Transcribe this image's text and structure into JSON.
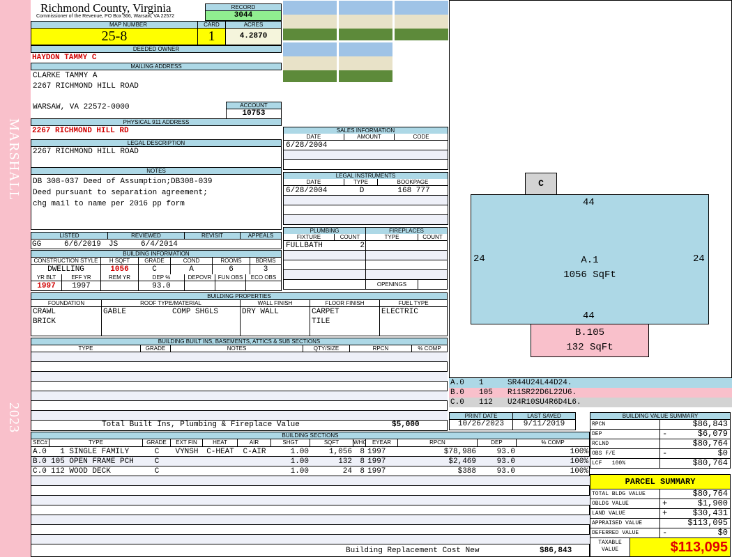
{
  "sidebar": {
    "name": "MARSHALL",
    "year": "2023"
  },
  "header": {
    "county": "Richmond County, Virginia",
    "subtitle": "Commissioner of the Revenue, PO Box 366, Warsaw, VA 22572",
    "record_label": "RECORD",
    "record": "3044"
  },
  "map": {
    "map_label": "MAP NUMBER",
    "map_number": "25-8",
    "card_label": "CARD",
    "card": "1",
    "acres_label": "ACRES",
    "acres": "4.2870"
  },
  "owner": {
    "label": "DEEDED OWNER",
    "value": "HAYDON TAMMY C"
  },
  "mailing": {
    "label": "MAILING ADDRESS",
    "line1": "CLARKE TAMMY A",
    "line2": "2267 RICHMOND HILL ROAD",
    "line3": "WARSAW, VA 22572-0000",
    "account_label": "ACCOUNT",
    "account": "10753"
  },
  "physical": {
    "label": "PHYSICAL 911 ADDRESS",
    "value": "2267 RICHMOND HILL RD"
  },
  "legal": {
    "label": "LEGAL DESCRIPTION",
    "value": "2267 RICHMOND HILL ROAD"
  },
  "notes": {
    "label": "NOTES",
    "lines": [
      "DB 308-037 Deed of Assumption;DB308-039",
      "Deed pursuant to separation agreement;",
      "chg mail to name per 2016 pp form"
    ]
  },
  "review": {
    "listed_label": "LISTED",
    "listed_by": "GG",
    "listed_date": "6/6/2019",
    "reviewed_label": "REVIEWED",
    "reviewed_by": "JS",
    "reviewed_date": "6/4/2014",
    "revisit_label": "REVISIT",
    "appeals_label": "APPEALS"
  },
  "building_info": {
    "label": "BUILDING INFORMATION",
    "h1": [
      "CONSTRUCTION STYLE",
      "H SQFT",
      "GRADE",
      "COND",
      "ROOMS",
      "BDRMS"
    ],
    "v1": [
      "DWELLING",
      "1056",
      "C",
      "A",
      "6",
      "3"
    ],
    "h2": [
      "YR BLT",
      "EFF YR",
      "REM YR",
      "DEP %",
      "DEPOVR",
      "FUN OBS",
      "ECO OBS"
    ],
    "v2": [
      "1997",
      "1997",
      "",
      "93.0",
      "",
      "",
      ""
    ]
  },
  "properties": {
    "label": "BUILDING PROPERTIES",
    "headers": [
      "FOUNDATION",
      "ROOF TYPE/MATERIAL",
      "WALL FINISH",
      "FLOOR FINISH",
      "FUEL TYPE"
    ],
    "values": [
      "CRAWL\nBRICK",
      "GABLE          COMP SHGLS",
      "DRY WALL",
      "CARPET\nTILE",
      "ELECTRIC"
    ]
  },
  "builtins": {
    "label": "BUILDING BUILT INS, BASEMENTS, ATTICS & SUB SECTIONS",
    "headers": [
      "TYPE",
      "GRADE",
      "NOTES",
      "QTY/SIZE",
      "RPCN",
      "% COMP"
    ],
    "total_label": "Total Built Ins, Plumbing & Fireplace Value",
    "total": "$5,000"
  },
  "sections": {
    "label": "BUILDING SECTIONS",
    "headers": [
      "SEC#",
      "TYPE",
      "GRADE",
      "EXT FIN",
      "HEAT",
      "AIR",
      "SHGT",
      "SQFT",
      "WHGT",
      "EYEAR",
      "RPCN",
      "DEP",
      "% COMP"
    ],
    "rows": [
      [
        "A.0",
        "  1 SINGLE FAMILY",
        "C",
        "VYNSH",
        "C-HEAT",
        "C-AIR",
        "1.00",
        "1,056",
        "8",
        "1997",
        "$78,986",
        "93.0",
        "100%"
      ],
      [
        "B.0",
        "105 OPEN FRAME PCH",
        "C",
        "",
        "",
        "",
        "1.00",
        "132",
        "8",
        "1997",
        "$2,469",
        "93.0",
        "100%"
      ],
      [
        "C.0",
        "112 WOOD DECK",
        "C",
        "",
        "",
        "",
        "1.00",
        "24",
        "8",
        "1997",
        "$388",
        "93.0",
        "100%"
      ]
    ],
    "replacement_label": "Building Replacement Cost New",
    "replacement": "$86,843"
  },
  "sales": {
    "label": "SALES INFORMATION",
    "headers": [
      "DATE",
      "AMOUNT",
      "CODE"
    ],
    "rows": [
      [
        "6/28/2004",
        "",
        ""
      ]
    ]
  },
  "instruments": {
    "label": "LEGAL INSTRUMENTS",
    "headers": [
      "DATE",
      "TYPE",
      "BOOKPAGE"
    ],
    "rows": [
      [
        "6/28/2004",
        "D",
        "168 777"
      ]
    ]
  },
  "plumbing": {
    "label": "PLUMBING",
    "headers": [
      "FIXTURE",
      "COUNT"
    ],
    "rows": [
      [
        "FULLBATH",
        "2"
      ]
    ]
  },
  "fireplaces": {
    "label": "FIREPLACES",
    "headers": [
      "TYPE",
      "COUNT"
    ],
    "openings_label": "OPENINGS"
  },
  "sketch": {
    "a_label": "A.1",
    "a_area": "1056 SqFt",
    "a_top": "44",
    "a_bottom": "44",
    "a_left": "24",
    "a_right": "24",
    "b_label": "B.105",
    "b_area": "132 SqFt",
    "c_label": "C",
    "legend": [
      {
        "sec": "A.0",
        "code": "1",
        "path": "SR44U24L44D24.",
        "color": "#add8e6"
      },
      {
        "sec": "B.0",
        "code": "105",
        "path": "R11SR22D6L22U6.",
        "color": "#f9c0cb"
      },
      {
        "sec": "C.0",
        "code": "112",
        "path": "U24R10SU4R6D4L6.",
        "color": "#d3d3d3"
      }
    ]
  },
  "dates": {
    "print_label": "PRINT DATE",
    "print": "10/26/2023",
    "saved_label": "LAST SAVED",
    "saved": "9/11/2019"
  },
  "value_summary": {
    "label": "BUILDING VALUE SUMMARY",
    "rows": [
      [
        "RPCN",
        "",
        "$86,843"
      ],
      [
        "DEP",
        "-",
        "$6,079"
      ],
      [
        "RCLND",
        "",
        "$80,764"
      ],
      [
        "OBS F/E",
        "-",
        "$0"
      ],
      [
        "LCF   100%",
        "",
        "$80,764"
      ]
    ]
  },
  "parcel": {
    "label": "PARCEL SUMMARY",
    "rows": [
      [
        "TOTAL BLDG VALUE",
        "",
        "$80,764"
      ],
      [
        "OBLDG VALUE",
        "+",
        "$1,900"
      ],
      [
        "LAND VALUE",
        "+",
        "$30,431"
      ],
      [
        "APPRAISED VALUE",
        "",
        "$113,095"
      ],
      [
        "DEFERRED VALUE",
        "-",
        "$0"
      ]
    ],
    "taxable_label": "TAXABLE VALUE",
    "taxable": "$113,095"
  }
}
